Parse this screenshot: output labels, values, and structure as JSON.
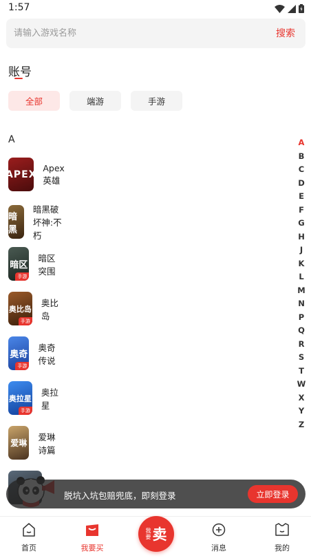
{
  "status_bar": {
    "time": "1:57"
  },
  "search": {
    "placeholder": "请输入游戏名称",
    "button": "搜索"
  },
  "page_title": "账号",
  "filters": [
    {
      "label": "全部",
      "active": true
    },
    {
      "label": "端游",
      "active": false
    },
    {
      "label": "手游",
      "active": false
    }
  ],
  "section_letter": "A",
  "games": [
    {
      "name": "Apex英雄",
      "icon_text": "APEX",
      "badge": "",
      "color": "#7a1515"
    },
    {
      "name": "暗黑破坏神:不朽",
      "icon_text": "暗黑",
      "badge": "",
      "color": "#5a3a1c"
    },
    {
      "name": "暗区突围",
      "icon_text": "暗区",
      "badge": "手游",
      "color": "#2b3a32"
    },
    {
      "name": "奥比岛",
      "icon_text": "奥比岛",
      "badge": "手游",
      "color": "#6b3b1e"
    },
    {
      "name": "奥奇传说",
      "icon_text": "奥奇",
      "badge": "手游",
      "color": "#2f62c9"
    },
    {
      "name": "奥拉星",
      "icon_text": "奥拉星",
      "badge": "手游",
      "color": "#1f63c6"
    },
    {
      "name": "爱琳诗篇",
      "icon_text": "爱琳",
      "badge": "",
      "color": "#7a5a3a"
    }
  ],
  "alphabet": [
    "A",
    "B",
    "C",
    "D",
    "E",
    "F",
    "G",
    "H",
    "J",
    "K",
    "L",
    "M",
    "N",
    "P",
    "Q",
    "R",
    "S",
    "T",
    "W",
    "X",
    "Y",
    "Z"
  ],
  "active_letter": "A",
  "login_banner": {
    "text": "脱坑入坑包赔兜底，即刻登录",
    "button": "立即登录"
  },
  "nav": {
    "home": "首页",
    "buy": "我要买",
    "sell_small": "我要",
    "sell_big": "卖",
    "messages": "消息",
    "mine": "我的"
  },
  "colors": {
    "accent": "#e8352e"
  }
}
